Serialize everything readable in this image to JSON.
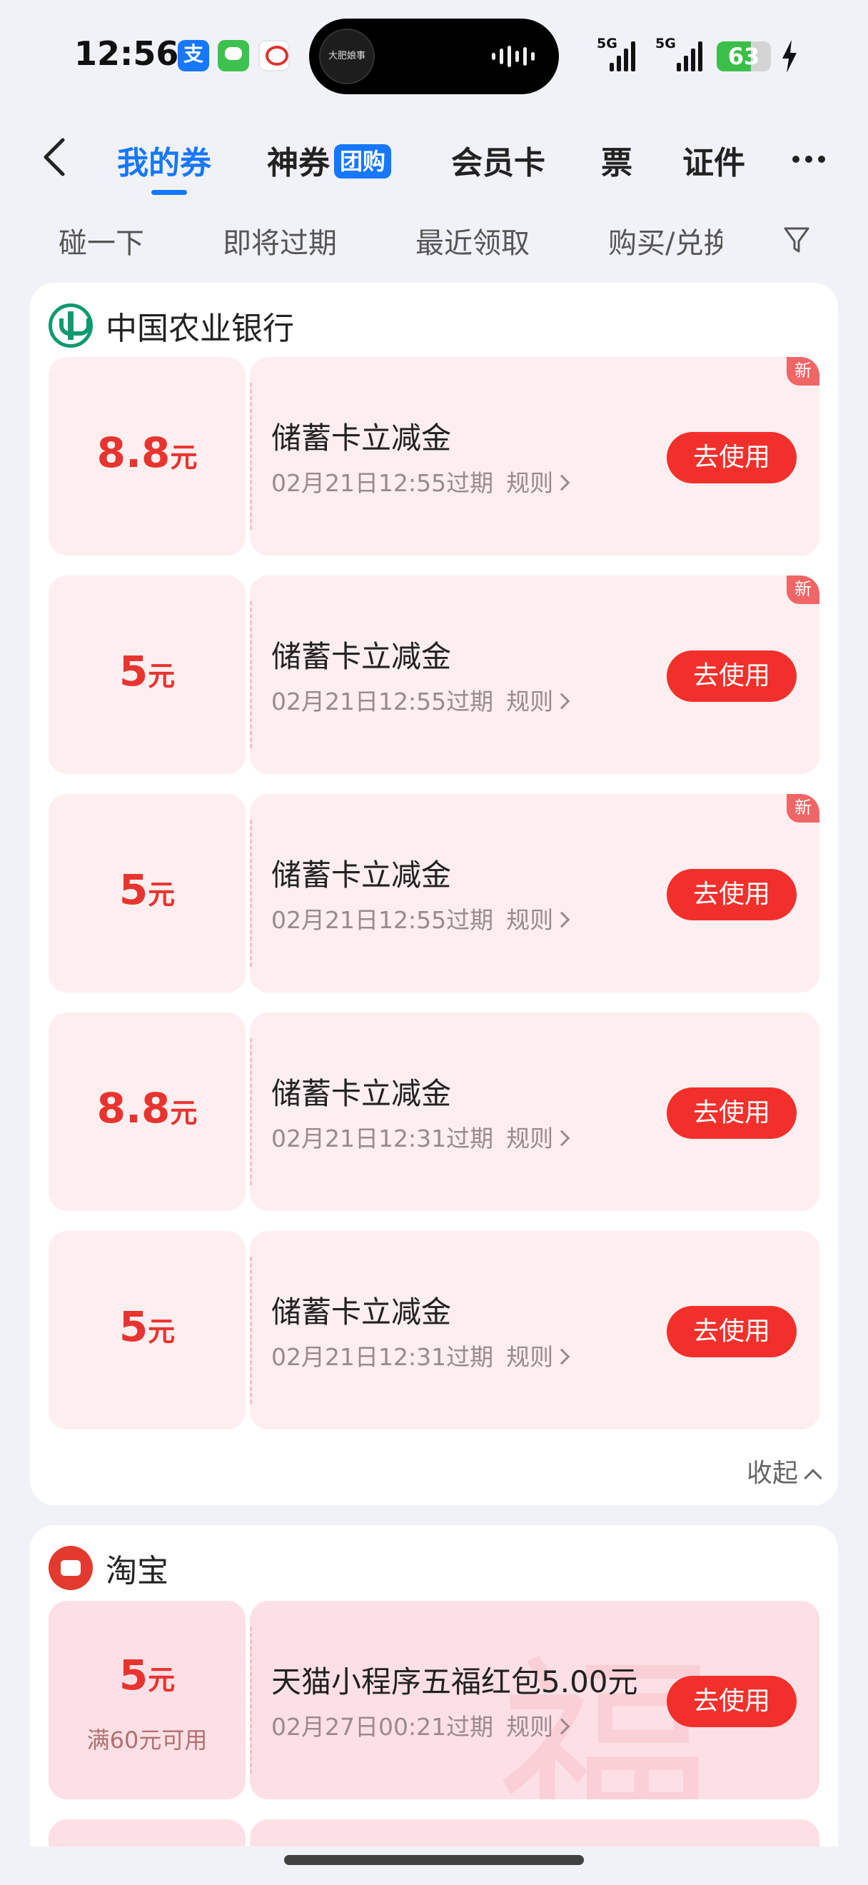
{
  "status_bar": {
    "time": "12:56",
    "app_icons": [
      "alipay-icon",
      "messages-icon",
      "telecom-icon"
    ],
    "alipay_glyph": "支",
    "island_caption": "大肥娘事",
    "net1": "5G",
    "net2": "5G",
    "battery": "63"
  },
  "nav": {
    "tabs": [
      "我的券",
      "神券",
      "会员卡",
      "票",
      "证件"
    ],
    "tag": "团购",
    "active_index": 0
  },
  "filters": [
    "碰一下",
    "即将过期",
    "最近领取",
    "购买/兑换"
  ],
  "sections": [
    {
      "name": "中国农业银行",
      "coupons": [
        {
          "amount": "8.8",
          "unit": "元",
          "title": "储蓄卡立减金",
          "expire": "02月21日12:55过期",
          "rule": "规则",
          "button": "去使用",
          "badge": "新"
        },
        {
          "amount": "5",
          "unit": "元",
          "title": "储蓄卡立减金",
          "expire": "02月21日12:55过期",
          "rule": "规则",
          "button": "去使用",
          "badge": "新"
        },
        {
          "amount": "5",
          "unit": "元",
          "title": "储蓄卡立减金",
          "expire": "02月21日12:55过期",
          "rule": "规则",
          "button": "去使用",
          "badge": "新"
        },
        {
          "amount": "8.8",
          "unit": "元",
          "title": "储蓄卡立减金",
          "expire": "02月21日12:31过期",
          "rule": "规则",
          "button": "去使用"
        },
        {
          "amount": "5",
          "unit": "元",
          "title": "储蓄卡立减金",
          "expire": "02月21日12:31过期",
          "rule": "规则",
          "button": "去使用"
        }
      ],
      "collapse": "收起"
    },
    {
      "name": "淘宝",
      "coupons": [
        {
          "amount": "5",
          "unit": "元",
          "condition": "满60元可用",
          "title": "天猫小程序五福红包5.00元",
          "expire": "02月27日00:21过期",
          "rule": "规则",
          "button": "去使用",
          "bg_glyph": "福"
        }
      ]
    }
  ],
  "colors": {
    "accent": "#1677ff",
    "red": "#f2302b",
    "coupon_bg": "#fdeef0",
    "bank_green": "#0d9a6e"
  }
}
